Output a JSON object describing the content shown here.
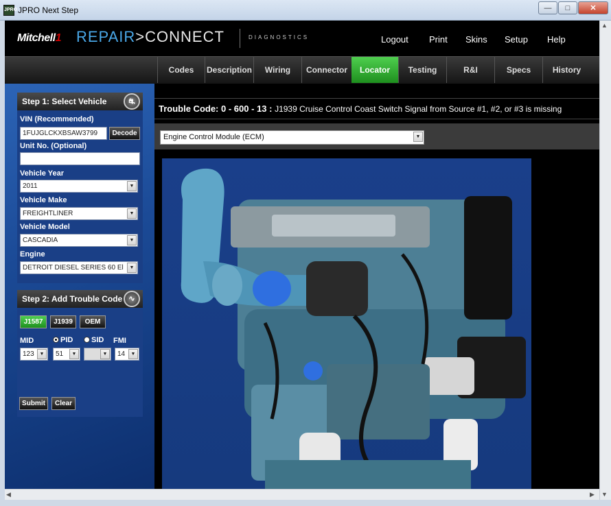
{
  "window": {
    "title": "JPRO Next Step",
    "icon_text": "JPRO",
    "minimize_icon": "minimize-icon",
    "maximize_icon": "maximize-icon",
    "close_icon": "close-icon"
  },
  "header": {
    "brand_mitchell": "Mitchell",
    "brand_mitchell_suffix": "1",
    "brand_repair": "REPAIR",
    "brand_connect": ">CONNECT",
    "brand_diagnostics": "DIAGNOSTICS",
    "nav": [
      "Logout",
      "Print",
      "Skins",
      "Setup",
      "Help"
    ]
  },
  "tabs": [
    {
      "label": "Codes",
      "active": false
    },
    {
      "label": "Description",
      "active": false
    },
    {
      "label": "Wiring",
      "active": false
    },
    {
      "label": "Connector",
      "active": false
    },
    {
      "label": "Locator",
      "active": true
    },
    {
      "label": "Testing",
      "active": false
    },
    {
      "label": "R&I",
      "active": false
    },
    {
      "label": "Specs",
      "active": false
    },
    {
      "label": "History",
      "active": false
    }
  ],
  "step1": {
    "title": "Step 1: Select Vehicle",
    "vin_label": "VIN (Recommended)",
    "vin_value": "1FUJGLCKXBSAW3799",
    "decode_label": "Decode",
    "unit_label": "Unit No. (Optional)",
    "unit_value": "",
    "year_label": "Vehicle Year",
    "year_value": "2011",
    "make_label": "Vehicle Make",
    "make_value": "FREIGHTLINER",
    "model_label": "Vehicle Model",
    "model_value": "CASCADIA",
    "engine_label": "Engine",
    "engine_value": "DETROIT DIESEL SERIES 60 El"
  },
  "step2": {
    "title": "Step 2: Add Trouble Code",
    "code_types": [
      {
        "label": "J1587",
        "active": true
      },
      {
        "label": "J1939",
        "active": false
      },
      {
        "label": "OEM",
        "active": false
      }
    ],
    "mid_label": "MID",
    "pid_label": "PID",
    "sid_label": "SID",
    "fmi_label": "FMI",
    "mid_value": "123",
    "pid_value": "51",
    "sid_value": "",
    "fmi_value": "14",
    "submit_label": "Submit",
    "clear_label": "Clear"
  },
  "main": {
    "trouble_code_prefix": "Trouble Code:",
    "trouble_code_value": "0 - 600 - 13 :",
    "trouble_code_desc": "J1939 Cruise Control Coast Switch Signal from Source #1, #2, or #3 is missing",
    "module_select": "Engine Control Module (ECM)"
  },
  "colors": {
    "active_tab": "#2aa52a",
    "panel": "#1a3f86",
    "header": "#000000"
  }
}
